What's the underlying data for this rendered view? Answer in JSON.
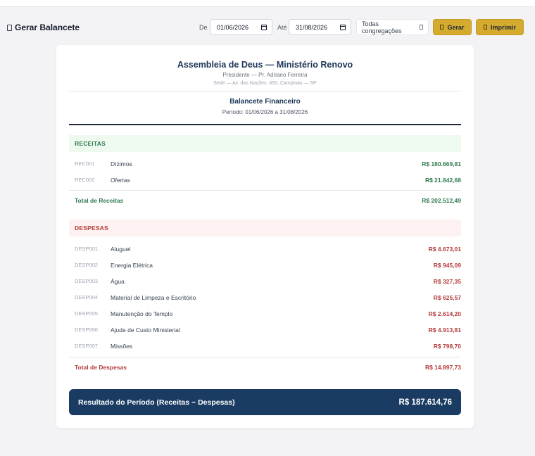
{
  "toolbar": {
    "title": "Gerar Balancete",
    "from_label": "De",
    "from_date": "01/06/2026",
    "to_label": "Até",
    "to_date": "31/08/2026",
    "congregation_select": "Todas congregações",
    "generate_button": "Gerar",
    "print_button": "Imprimir",
    "accent_color": "#d4ab2e"
  },
  "report": {
    "org_name": "Assembleia de Deus — Ministério Renovo",
    "president": "Presidente — Pr. Adriano Ferreira",
    "address": "Sede — Av. das Nações, 450, Campinas — SP",
    "title": "Balancete Financeiro",
    "period": "Período: 01/06/2026 a 31/08/2026"
  },
  "receitas": {
    "heading": "RECEITAS",
    "color": "#2f7a4f",
    "rows": [
      {
        "code": "REC001",
        "name": "Dízimos",
        "value": "R$ 180.669,81"
      },
      {
        "code": "REC002",
        "name": "Ofertas",
        "value": "R$ 21.842,68"
      }
    ],
    "total_label": "Total de Receitas",
    "total_value": "R$ 202.512,49"
  },
  "despesas": {
    "heading": "DESPESAS",
    "color": "#b43a3a",
    "rows": [
      {
        "code": "DESP001",
        "name": "Aluguel",
        "value": "R$ 4.673,01"
      },
      {
        "code": "DESP002",
        "name": "Energia Elétrica",
        "value": "R$ 945,09"
      },
      {
        "code": "DESP003",
        "name": "Água",
        "value": "R$ 327,35"
      },
      {
        "code": "DESP004",
        "name": "Material de Limpeza e Escritório",
        "value": "R$ 625,57"
      },
      {
        "code": "DESP005",
        "name": "Manutenção do Templo",
        "value": "R$ 2.614,20"
      },
      {
        "code": "DESP006",
        "name": "Ajuda de Custo Ministerial",
        "value": "R$ 4.913,81"
      },
      {
        "code": "DESP007",
        "name": "Missões",
        "value": "R$ 798,70"
      }
    ],
    "total_label": "Total de Despesas",
    "total_value": "R$ 14.897,73"
  },
  "result": {
    "label": "Resultado do Período (Receitas − Despesas)",
    "value": "R$ 187.614,76",
    "color": "#1a3c63"
  }
}
